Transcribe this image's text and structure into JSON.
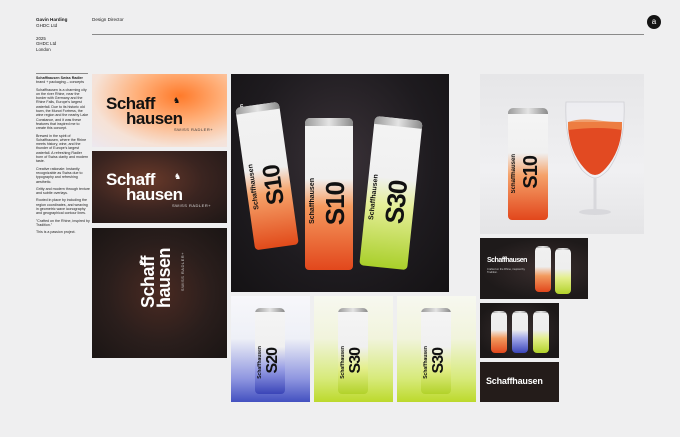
{
  "header": {
    "name": "Gavin Harding",
    "company": "GHDC Ltd",
    "role": "Design Director",
    "logo": "a"
  },
  "meta": {
    "year": "2025",
    "company": "GHDC Ltd",
    "city": "London"
  },
  "project": {
    "title": "Schaffhausen Swiss Radler",
    "subtitle": "brand + packaging – concepts",
    "paragraphs": [
      "Schaffhausen is a charming city on the river Rhine, near the border with Germany and the Rhine Falls, Europe's largest waterfall. Due to its historic old town, the Munot Fortress, the wine region and the nearby Lake Constance, and it was these features that inspired me to create this concept.",
      "Brewed in the spirit of Schaffhausen, where the Rhine meets history, wine, and the thunder of Europe's largest waterfall. A refreshing Radler born of Swiss clarity and modern taste.",
      "Creative rationale: Instantly recognizable as Swiss due to typography and refreshing aesthetic.",
      "Gritty and modern through texture and subtle overlays.",
      "Rooted in place by including the region coordinates, and weaving in geometric wave iconography and geographical contour lines.",
      "\"Crafted on the Rhine, inspired by Tradition.\"",
      "This is a passion project."
    ]
  },
  "brand": {
    "wordmark_line1": "Schaff",
    "wordmark_line2": "hausen",
    "wordmark_full": "Schaffhausen",
    "tagline": "SWISS RADLER+",
    "sku_10": "S10",
    "sku_20": "S20",
    "sku_30": "S30",
    "showcase_headline": "Schaffhausen",
    "showcase_sub": "Crafted on the Rhine, inspired by Tradition."
  },
  "colors": {
    "background": "#efeff0",
    "ink": "#141414",
    "orange": "#f06a1e",
    "blue": "#3a45b8",
    "green": "#b7d22a",
    "dark": "#2b2220"
  }
}
